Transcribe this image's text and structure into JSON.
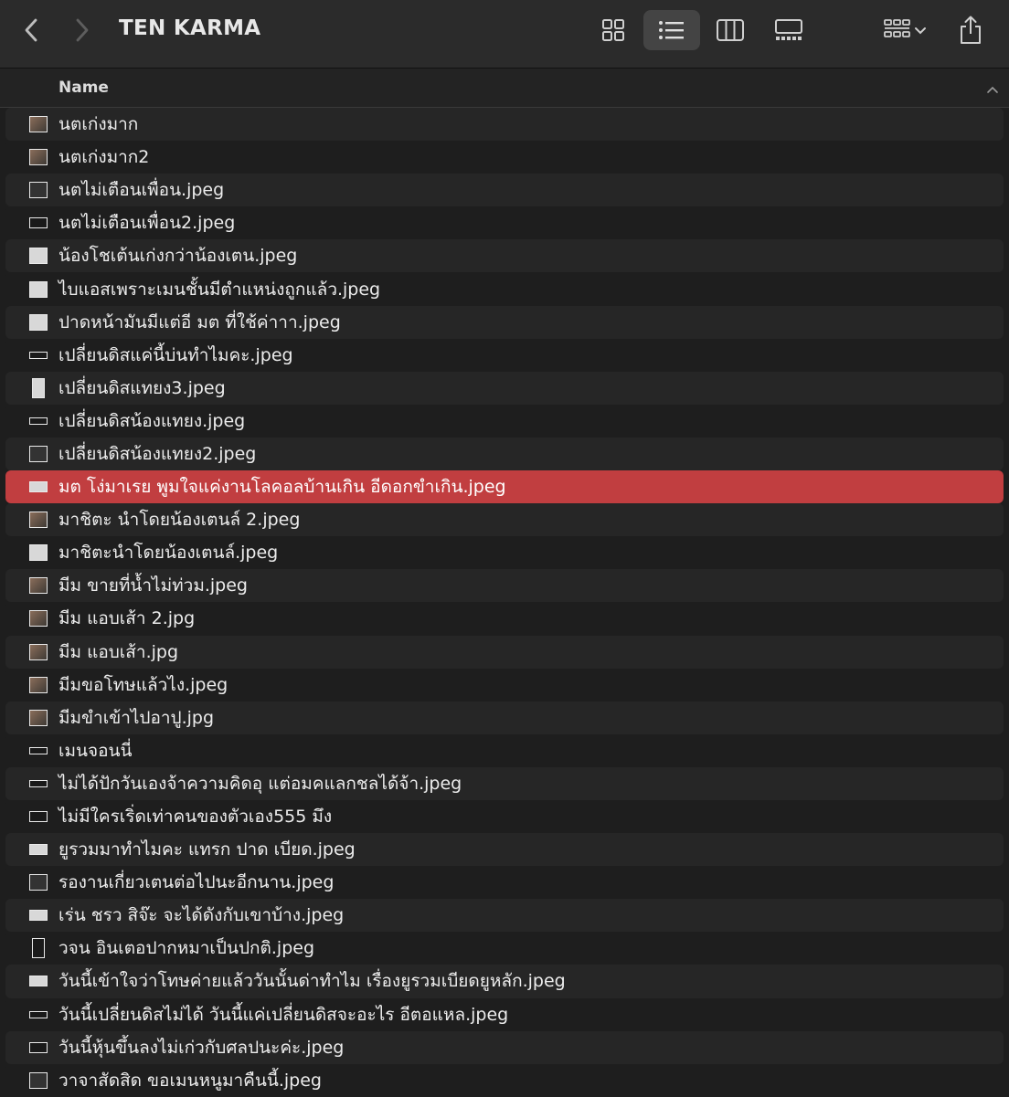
{
  "window": {
    "title": "TEN KARMA"
  },
  "toolbar": {
    "back_icon": "chevron-left-icon",
    "forward_icon": "chevron-right-icon",
    "views": [
      "icon-view-icon",
      "list-view-icon",
      "column-view-icon",
      "gallery-view-icon"
    ],
    "active_view": "list-view-icon",
    "group_icon": "group-by-icon",
    "share_icon": "share-icon"
  },
  "header": {
    "name_label": "Name",
    "sort": "ascending"
  },
  "colors": {
    "selection": "#c13e40",
    "background": "#1e1e1e",
    "row_alt": "#262626"
  },
  "files": [
    {
      "name": "นตเก่งมาก",
      "thumb": "photo"
    },
    {
      "name": "นตเก่งมาก2",
      "thumb": "photo"
    },
    {
      "name": "นตไม่เตือนเพื่อน.jpeg",
      "thumb": "dark"
    },
    {
      "name": "นตไม่เตือนเพื่อน2.jpeg",
      "thumb": "wide"
    },
    {
      "name": "น้องโชเต้นเก่งกว่าน้องเตน.jpeg",
      "thumb": "light"
    },
    {
      "name": "ไบแอสเพราะเมนชั้นมีตำแหน่งถูกแล้ว.jpeg",
      "thumb": "light"
    },
    {
      "name": "ปาดหน้ามันมีแต่อี มต ที่ใช้ค่าาา.jpeg",
      "thumb": "light"
    },
    {
      "name": "เปลี่ยนดิสแค่นี้บ่นทำไมคะ.jpeg",
      "thumb": "slim"
    },
    {
      "name": "เปลี่ยนดิสแทยง3.jpeg",
      "thumb": "tall-light"
    },
    {
      "name": "เปลี่ยนดิสน้องแทยง.jpeg",
      "thumb": "slim"
    },
    {
      "name": "เปลี่ยนดิสน้องแทยง2.jpeg",
      "thumb": "dark"
    },
    {
      "name": "มต โง่มาเรย พูมใจแค่งานโลคอลบ้านเกิน อีดอกขำเกิน.jpeg",
      "thumb": "wide-light",
      "selected": true
    },
    {
      "name": "มาชิตะ นำโดยน้องเตนล์ 2.jpeg",
      "thumb": "photo"
    },
    {
      "name": "มาชิตะนำโดยน้องเตนล์.jpeg",
      "thumb": "light"
    },
    {
      "name": "มีม ขายที่น้ำไม่ท่วม.jpeg",
      "thumb": "photo"
    },
    {
      "name": "มีม แอบเส้า 2.jpg",
      "thumb": "photo"
    },
    {
      "name": "มีม แอบเส้า.jpg",
      "thumb": "photo"
    },
    {
      "name": "มีมขอโทษแล้วไง.jpeg",
      "thumb": "photo"
    },
    {
      "name": "มีมขำเข้าไปอาปู.jpg",
      "thumb": "photo"
    },
    {
      "name": "เมนจอนนี่",
      "thumb": "slim"
    },
    {
      "name": "ไม่ได้ปักวันเองจ้าความคิดอุ แต่อมคแลกชลได้จ้า.jpeg",
      "thumb": "slim"
    },
    {
      "name": "ไม่มีใครเริ่ดเท่าคนของตัวเอง555 มึง",
      "thumb": "wide"
    },
    {
      "name": "ยูรวมมาทำไมคะ แทรก ปาด เบียด.jpeg",
      "thumb": "wide-light"
    },
    {
      "name": "รองานเกี่ยวเตนต่อไปนะอีกนาน.jpeg",
      "thumb": "dark"
    },
    {
      "name": "เร่น ชรว สิจ๊ะ จะได้ดังกับเขาบ้าง.jpeg",
      "thumb": "wide-light"
    },
    {
      "name": "วจน อินเตอปากหมาเป็นปกติ.jpeg",
      "thumb": "tall"
    },
    {
      "name": "วันนี้เข้าใจว่าโทษค่ายแล้ววันนั้นด่าทำไม เรื่องยูรวมเบียดยูหลัก.jpeg",
      "thumb": "wide-light"
    },
    {
      "name": "วันนี้เปลี่ยนดิสไม่ได้ วันนี้แค่เปลี่ยนดิสจะอะไร อีตอแหล.jpeg",
      "thumb": "slim"
    },
    {
      "name": "วันนี้หุ้นขึ้นลงไม่เก่วกับศลปนะค่ะ.jpeg",
      "thumb": "wide"
    },
    {
      "name": "วาจาสัดสิด ขอเมนหนูมาคืนนี้.jpeg",
      "thumb": "dark"
    }
  ]
}
